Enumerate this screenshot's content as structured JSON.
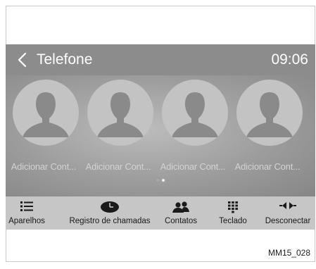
{
  "header": {
    "back_icon": "chevron-left-icon",
    "title": "Telefone",
    "clock": "09:06"
  },
  "contacts": [
    {
      "label": "Adicionar Cont..."
    },
    {
      "label": "Adicionar Cont..."
    },
    {
      "label": "Adicionar Cont..."
    },
    {
      "label": "Adicionar Cont..."
    }
  ],
  "pager": {
    "pages": 2,
    "current": 2
  },
  "tabs": [
    {
      "label": "Aparelhos",
      "icon": "list-icon"
    },
    {
      "label": "Registro de chamadas",
      "icon": "clock-icon"
    },
    {
      "label": "Contatos",
      "icon": "people-icon"
    },
    {
      "label": "Teclado",
      "icon": "keypad-icon"
    },
    {
      "label": "Desconectar",
      "icon": "disconnect-icon"
    }
  ],
  "caption": "MM15_028",
  "colors": {
    "header_bg": "#8c8c8c",
    "tabbar_bg": "#c6c6c6",
    "avatar_bg": "#c3c3c3",
    "silhouette": "#8a8a8a"
  }
}
